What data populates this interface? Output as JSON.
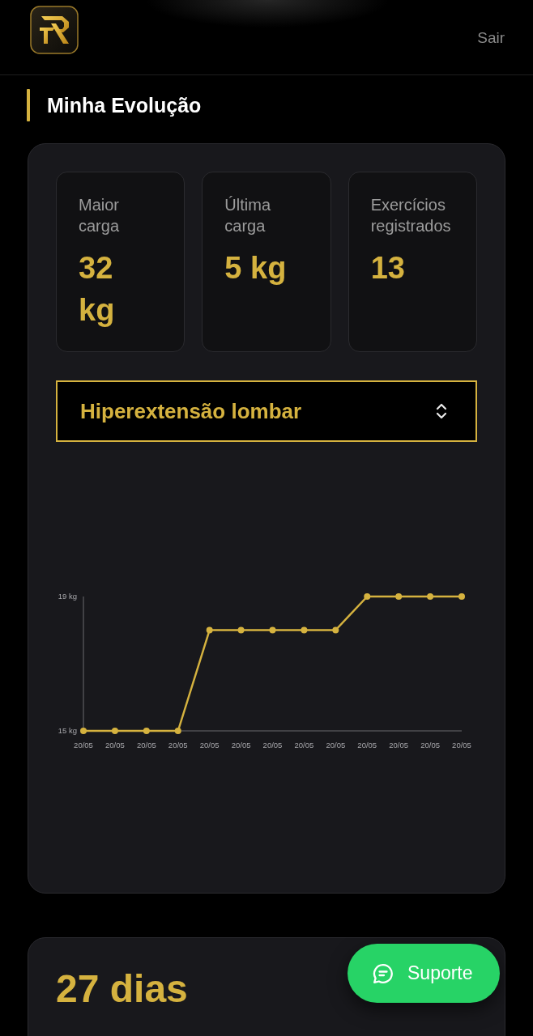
{
  "header": {
    "logout_link": "Sair"
  },
  "page_title": "Minha Evolução",
  "stats": [
    {
      "label": "Maior carga",
      "value": "32 kg"
    },
    {
      "label": "Última carga",
      "value": "5 kg"
    },
    {
      "label": "Exercícios registrados",
      "value": "13"
    }
  ],
  "exercise_select": {
    "value": "Hiperextensão lombar"
  },
  "chart": {
    "chart_data": {
      "type": "line",
      "marker": "circle",
      "categories": [
        "20/05",
        "20/05",
        "20/05",
        "20/05",
        "20/05",
        "20/05",
        "20/05",
        "20/05",
        "20/05",
        "20/05",
        "20/05",
        "20/05",
        "20/05"
      ],
      "values": [
        15,
        15,
        15,
        15,
        18,
        18,
        18,
        18,
        18,
        19,
        19,
        19,
        19
      ],
      "ylim": [
        15,
        19
      ],
      "yticks": [
        {
          "value": 15,
          "label": "15 kg"
        },
        {
          "value": 19,
          "label": "19 kg"
        }
      ]
    }
  },
  "streak_card": {
    "value": "27 dias"
  },
  "support_button": {
    "label": "Suporte"
  }
}
